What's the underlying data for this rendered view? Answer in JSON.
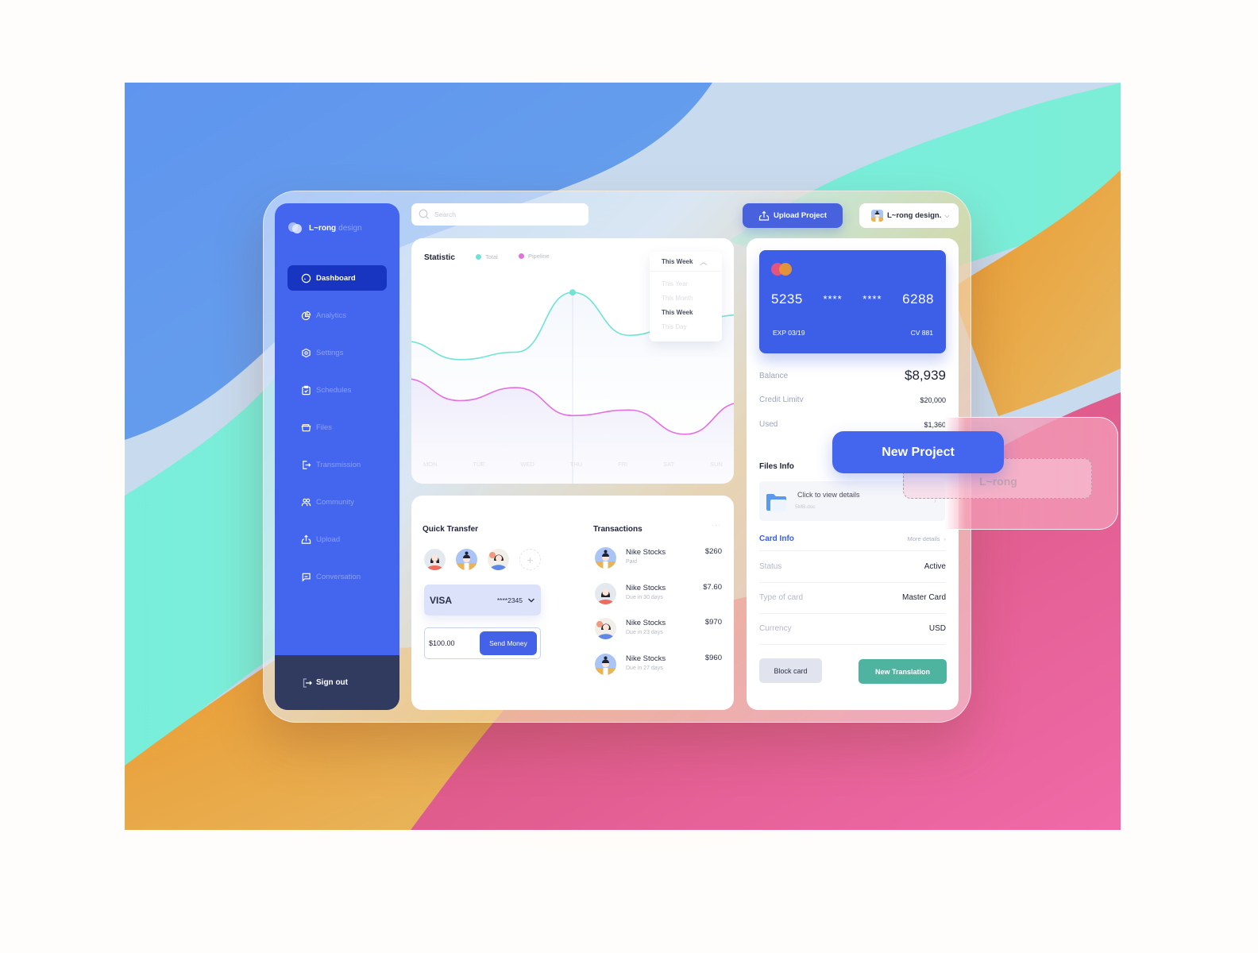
{
  "colors": {
    "primary": "#4466ee",
    "sidebar_active": "#1735c0",
    "sidebar_footer": "#313a5f",
    "series_total": "#6fe4d5",
    "series_pipeline": "#e36fe3",
    "accent_green": "#4fb49f",
    "card_link": "#3a5be6"
  },
  "brand": {
    "name": "L~rong",
    "suffix": "design",
    "logo_icon": "overlapping-circles-icon"
  },
  "sidebar": {
    "items": [
      {
        "label": "Dashboard",
        "icon": "dashboard-gauge-icon",
        "active": true
      },
      {
        "label": "Analytics",
        "icon": "pie-chart-icon",
        "active": false
      },
      {
        "label": "Settings",
        "icon": "hexagon-settings-icon",
        "active": false
      },
      {
        "label": "Schedules",
        "icon": "clipboard-check-icon",
        "active": false
      },
      {
        "label": "Files",
        "icon": "folder-open-icon",
        "active": false
      },
      {
        "label": "Transmission",
        "icon": "export-arrow-icon",
        "active": false
      },
      {
        "label": "Community",
        "icon": "users-icon",
        "active": false
      },
      {
        "label": "Upload",
        "icon": "upload-icon",
        "active": false
      },
      {
        "label": "Conversation",
        "icon": "chat-bubble-icon",
        "active": false
      }
    ],
    "signout_label": "Sign out"
  },
  "search": {
    "placeholder": "Search",
    "value": ""
  },
  "header": {
    "upload_button": "Upload Project",
    "user_name": "L~rong design."
  },
  "statistic": {
    "title": "Statistic",
    "legend": [
      "Total",
      "Pipeline"
    ],
    "period_selected": "This Week",
    "period_options": [
      "This Year",
      "This Month",
      "This Week",
      "This Day"
    ]
  },
  "chart_data": {
    "type": "line",
    "title": "Statistic",
    "categories": [
      "MON",
      "TUE",
      "WED",
      "THU",
      "FRI",
      "SAT",
      "SUN"
    ],
    "series": [
      {
        "name": "Total",
        "values": [
          0.62,
          0.52,
          0.56,
          0.88,
          0.65,
          0.72,
          0.76
        ]
      },
      {
        "name": "Pipeline",
        "values": [
          0.42,
          0.3,
          0.37,
          0.22,
          0.25,
          0.12,
          0.29
        ]
      }
    ],
    "highlight": {
      "category": "THU",
      "series": "Total"
    },
    "xlabel": "",
    "ylabel": "",
    "grid": false,
    "legend_position": "top-left"
  },
  "quick_transfer": {
    "title": "Quick Transfer",
    "contacts": [
      "contact-1",
      "contact-2",
      "contact-3"
    ],
    "add_label": "+",
    "card_brand": "VISA",
    "card_number": "****2345",
    "amount": "$100.00",
    "send_label": "Send Money"
  },
  "transactions": {
    "title": "Transactions",
    "more": "···",
    "items": [
      {
        "name": "Nike Stocks",
        "status": "Paid",
        "amount": "$260"
      },
      {
        "name": "Nike Stocks",
        "status": "Due in 30 days",
        "amount": "$7.60"
      },
      {
        "name": "Nike Stocks",
        "status": "Due in 23 days",
        "amount": "$970"
      },
      {
        "name": "Nike Stocks",
        "status": "Due in 27 days",
        "amount": "$960"
      }
    ]
  },
  "card": {
    "number_first": "5235",
    "number_mask_1": "****",
    "number_mask_2": "****",
    "number_last": "6288",
    "exp": "EXP 03/19",
    "cv": "CV 881",
    "balance_label": "Balance",
    "balance": "$8,939",
    "credit_label": "Credit Limitv",
    "credit": "$20,000",
    "used_label": "Used",
    "used": "$1,360"
  },
  "files": {
    "title": "Files Info",
    "item_label": "Click to view details",
    "item_file": "5MB.doc"
  },
  "card_info": {
    "title": "Card Info",
    "more": "More details",
    "rows": [
      {
        "key": "Status",
        "value": "Active"
      },
      {
        "key": "Type of card",
        "value": "Master Card"
      },
      {
        "key": "Currency",
        "value": "USD"
      }
    ],
    "block_label": "Block card",
    "new_translation_label": "New Translation"
  },
  "overlay": {
    "new_project_label": "New Project",
    "drop_label": "L~rong"
  }
}
